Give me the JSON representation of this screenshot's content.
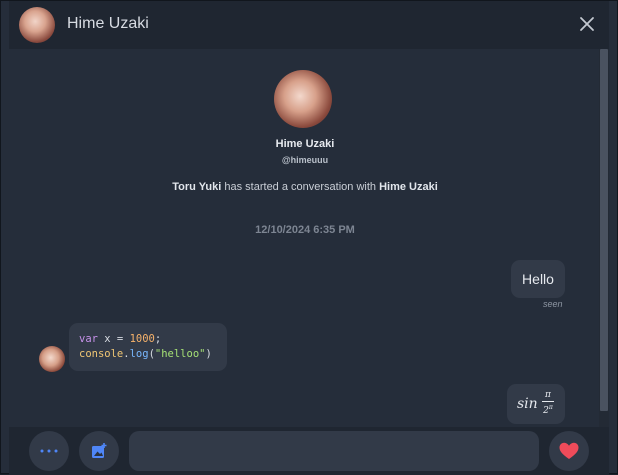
{
  "header": {
    "title": "Hime Uzaki",
    "avatar_icon": "user-avatar-icon",
    "close_icon": "close-icon"
  },
  "intro": {
    "name": "Hime Uzaki",
    "handle": "@himeuuu",
    "starter": "Toru Yuki",
    "line_middle": " has started a conversation with ",
    "recipient": "Hime Uzaki"
  },
  "timestamp": "12/10/2024 6:35 PM",
  "messages": [
    {
      "from": "me",
      "text": "Hello",
      "status": "seen"
    },
    {
      "from": "Hime Uzaki",
      "code": {
        "line1": {
          "kw": "var",
          "name": " x = ",
          "num": "1000",
          "end": ";"
        },
        "line2": {
          "obj": "console",
          "dot": ".",
          "fn": "log",
          "open": "(",
          "str": "\"helloo\"",
          "close": ")"
        }
      }
    },
    {
      "from": "me",
      "math": {
        "func": "sin",
        "numerator": "π",
        "denominator": "2",
        "exponent": "π"
      }
    }
  ],
  "composer": {
    "more_icon": "more-horizontal-icon",
    "image_icon": "image-add-icon",
    "input_value": "",
    "heart_icon": "heart-icon"
  },
  "colors": {
    "background": "#252d3a",
    "header": "#1f2631",
    "bubble": "#323a48",
    "accent_blue": "#4f86f7",
    "heart_red": "#ef4b5a"
  }
}
